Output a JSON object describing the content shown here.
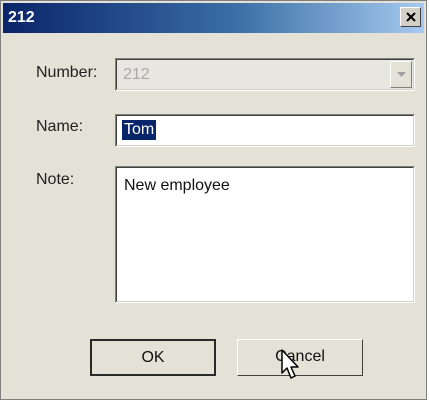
{
  "window": {
    "title": "212"
  },
  "form": {
    "number_label": "Number:",
    "number_value": "212",
    "name_label": "Name:",
    "name_value": "Tom",
    "note_label": "Note:",
    "note_value": "New employee"
  },
  "buttons": {
    "ok_label": "OK",
    "cancel_label": "Cancel"
  },
  "icons": {
    "close": "close-icon",
    "dropdown": "chevron-down-icon",
    "cursor": "mouse-pointer-icon"
  },
  "colors": {
    "titlebar_start": "#0a246a",
    "titlebar_end": "#a6caf0",
    "selection": "#0a246a",
    "dialog_bg": "#e4e1d7"
  }
}
